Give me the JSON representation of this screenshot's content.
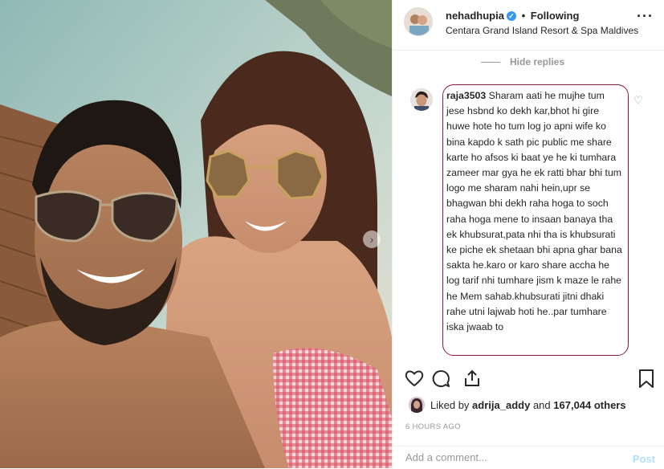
{
  "post": {
    "photo_alt": "Selfie of a couple wearing sunglasses at a beach resort",
    "carousel_next_icon": "chevron-right-icon"
  },
  "header": {
    "username": "nehadhupia",
    "separator": "•",
    "follow_status": "Following",
    "location": "Centara Grand Island Resort & Spa Maldives",
    "more_label": "···"
  },
  "thread": {
    "hide_replies_label": "Hide replies",
    "comment": {
      "username": "raja3503",
      "text": "Sharam aati he mujhe tum jese hsbnd ko dekh kar,bhot hi gire huwe hote ho tum log jo apni wife ko bina kapdo k sath pic public me share karte ho afsos ki baat ye he ki tumhara zameer mar gya he ek ratti bhar bhi tum logo me sharam nahi hein,upr se bhagwan bhi dekh raha hoga to soch raha hoga mene to insaan banaya tha ek khubsurat,pata nhi tha is khubsurati ke piche ek shetaan bhi apna ghar bana sakta he.karo or karo share accha he log tarif nhi tumhare jism k maze le rahe he Mem sahab.khubsurati jitni dhaki rahe utni lajwab hoti he..par tumhare iska jwaab to"
    }
  },
  "likes": {
    "prefix": "Liked by",
    "user": "adrija_addy",
    "connector": "and",
    "count": "167,044 others"
  },
  "timestamp": "6 HOURS AGO",
  "add_comment": {
    "placeholder": "Add a comment...",
    "post_label": "Post"
  },
  "colors": {
    "highlight_border": "#8b1c35",
    "verified_badge": "#3897f0",
    "post_button_disabled": "#b2dffc"
  }
}
